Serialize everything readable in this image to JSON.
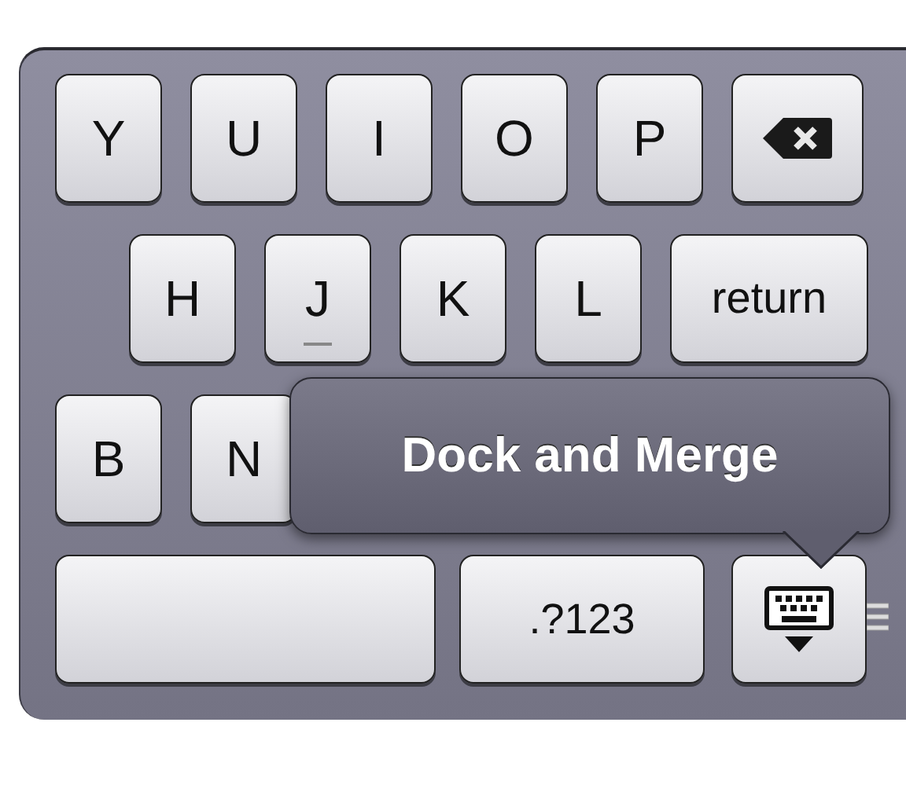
{
  "keyboard": {
    "rows": [
      {
        "keys": [
          {
            "kind": "letter",
            "label": "Y"
          },
          {
            "kind": "letter",
            "label": "U"
          },
          {
            "kind": "letter",
            "label": "I"
          },
          {
            "kind": "letter",
            "label": "O"
          },
          {
            "kind": "letter",
            "label": "P"
          },
          {
            "kind": "delete"
          }
        ]
      },
      {
        "keys": [
          {
            "kind": "letter",
            "label": "H"
          },
          {
            "kind": "letter",
            "label": "J",
            "home_bump": true
          },
          {
            "kind": "letter",
            "label": "K"
          },
          {
            "kind": "letter",
            "label": "L"
          },
          {
            "kind": "return",
            "label": "return"
          }
        ]
      },
      {
        "keys": [
          {
            "kind": "letter",
            "label": "B"
          },
          {
            "kind": "letter",
            "label": "N"
          }
        ]
      },
      {
        "keys": [
          {
            "kind": "space"
          },
          {
            "kind": "numbers",
            "label": ".?123"
          },
          {
            "kind": "hide"
          }
        ]
      }
    ]
  },
  "popover": {
    "label": "Dock and Merge"
  }
}
